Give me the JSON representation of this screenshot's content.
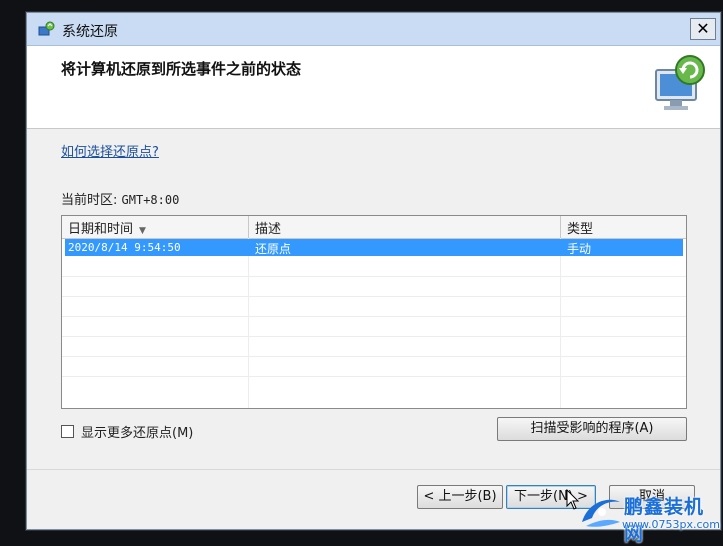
{
  "window": {
    "title": "系统还原",
    "close_label": "✕"
  },
  "header": {
    "title": "将计算机还原到所选事件之前的状态"
  },
  "help_link": "如何选择还原点?",
  "timezone": {
    "label": "当前时区:",
    "value": "GMT+8:00"
  },
  "table": {
    "columns": [
      "日期和时间",
      "描述",
      "类型"
    ],
    "rows": [
      {
        "datetime": "2020/8/14 9:54:50",
        "description": "还原点",
        "type": "手动",
        "selected": true
      }
    ]
  },
  "show_more": {
    "label": "显示更多还原点(M)",
    "checked": false
  },
  "buttons": {
    "scan": "扫描受影响的程序(A)",
    "back": "< 上一步(B)",
    "next": "下一步(N) >",
    "cancel": "取消"
  },
  "watermark": {
    "name": "鹏鑫装机网",
    "url": "www.0753px.com"
  },
  "colors": {
    "selection": "#3399ff",
    "titlebar": "#c9dcf3",
    "link": "#1a4f9c"
  }
}
